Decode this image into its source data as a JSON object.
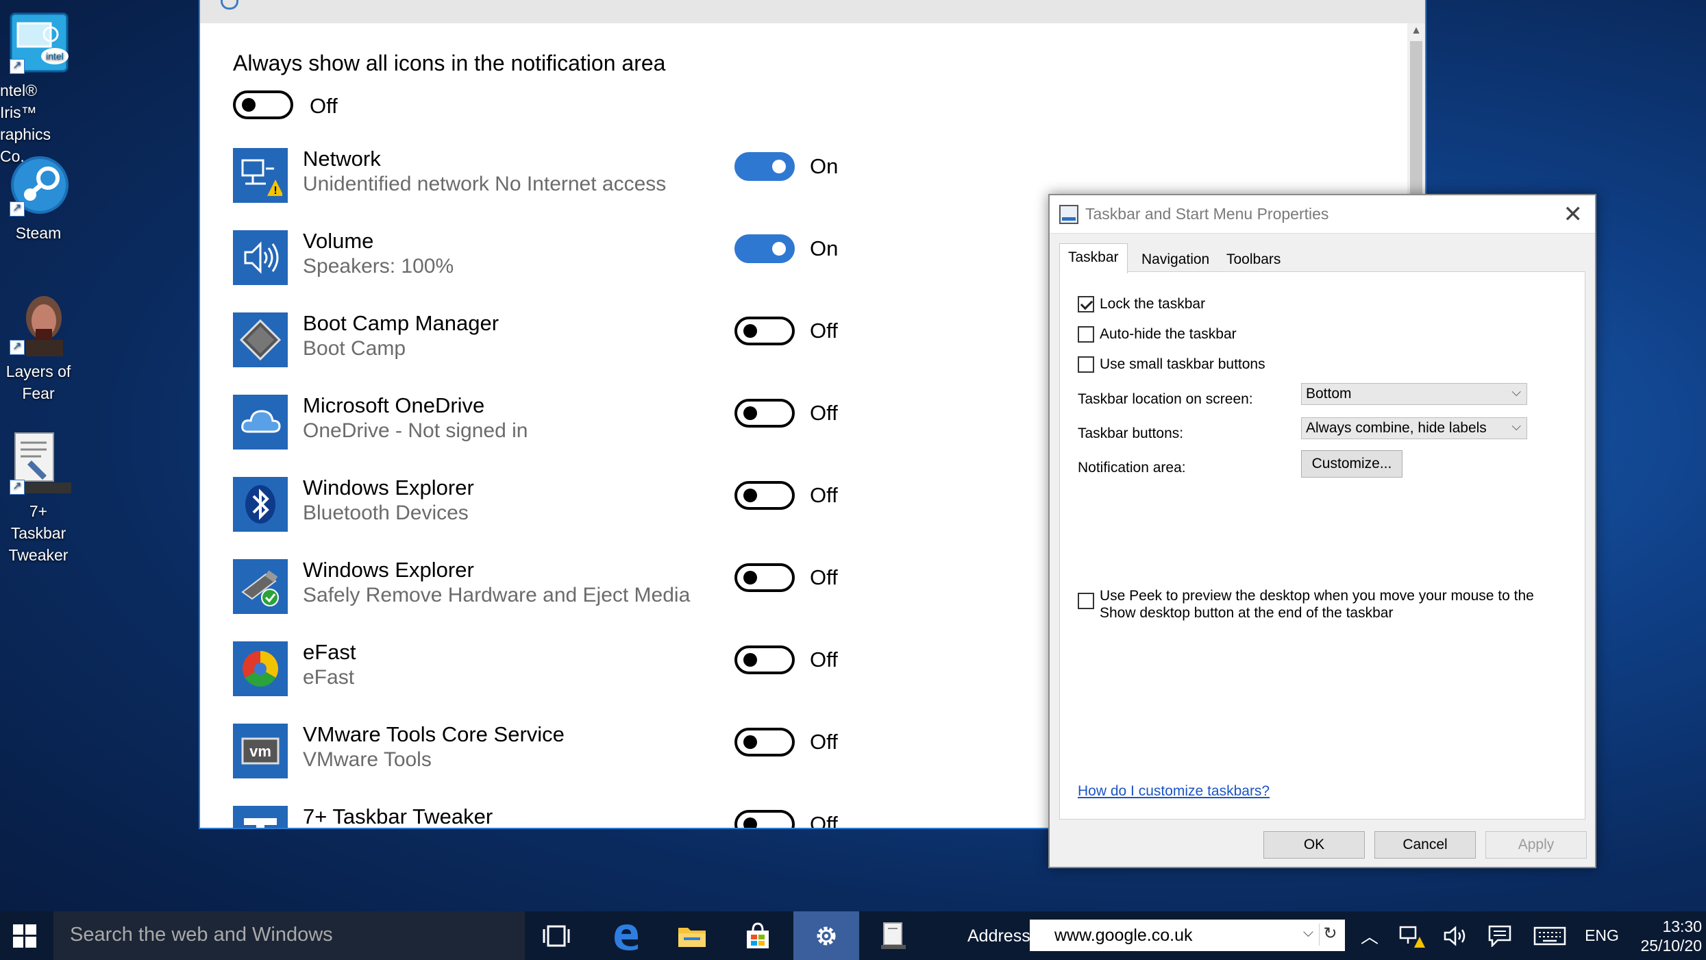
{
  "desktop": {
    "icons": [
      {
        "label": "ntel® Iris™\nraphics Co...",
        "line1": "ntel® Iris™",
        "line2": "raphics Co..."
      },
      {
        "line1": "Steam",
        "line2": ""
      },
      {
        "line1": "Layers of",
        "line2": "Fear"
      },
      {
        "line1": "7+ Taskbar",
        "line2": "Tweaker"
      }
    ]
  },
  "settings": {
    "always_show_title": "Always show all icons in the notification area",
    "always_show_state": "Off",
    "apps": [
      {
        "name": "Network",
        "sub": "Unidentified network No Internet access",
        "state": "On",
        "on": true,
        "icon": "network-warning-icon"
      },
      {
        "name": "Volume",
        "sub": "Speakers: 100%",
        "state": "On",
        "on": true,
        "icon": "speaker-icon"
      },
      {
        "name": "Boot Camp Manager",
        "sub": "Boot Camp",
        "state": "Off",
        "on": false,
        "icon": "bootcamp-diamond-icon"
      },
      {
        "name": "Microsoft OneDrive",
        "sub": "OneDrive - Not signed in",
        "state": "Off",
        "on": false,
        "icon": "cloud-icon"
      },
      {
        "name": "Windows Explorer",
        "sub": "Bluetooth Devices",
        "state": "Off",
        "on": false,
        "icon": "bluetooth-icon"
      },
      {
        "name": "Windows Explorer",
        "sub": "Safely Remove Hardware and Eject Media",
        "state": "Off",
        "on": false,
        "icon": "usb-eject-icon"
      },
      {
        "name": "eFast",
        "sub": "eFast",
        "state": "Off",
        "on": false,
        "icon": "efast-icon"
      },
      {
        "name": "VMware Tools Core Service",
        "sub": "VMware Tools",
        "state": "Off",
        "on": false,
        "icon": "vmware-icon"
      },
      {
        "name": "7+ Taskbar Tweaker",
        "sub": "",
        "state": "Off",
        "on": false,
        "icon": "taskbar-tweaker-icon"
      }
    ]
  },
  "dialog": {
    "title": "Taskbar and Start Menu Properties",
    "tabs": [
      "Taskbar",
      "Navigation",
      "Toolbars"
    ],
    "lock_taskbar": "Lock the taskbar",
    "auto_hide": "Auto-hide the taskbar",
    "small_buttons": "Use small taskbar buttons",
    "location_label": "Taskbar location on screen:",
    "location_value": "Bottom",
    "buttons_label": "Taskbar buttons:",
    "buttons_value": "Always combine, hide labels",
    "notification_label": "Notification area:",
    "customize_button": "Customize...",
    "peek_text": "Use Peek to preview the desktop when you move your mouse to the Show desktop button at the end of the taskbar",
    "help_link": "How do I customize taskbars?",
    "ok": "OK",
    "cancel": "Cancel",
    "apply": "Apply",
    "checked": {
      "lock": true,
      "autohide": false,
      "small": false,
      "peek": false
    }
  },
  "taskbar": {
    "search_placeholder": "Search the web and Windows",
    "address_label": "Address",
    "address_value": "www.google.co.uk",
    "language": "ENG",
    "time": "13:30",
    "date": "25/10/20"
  },
  "colors": {
    "accent": "#2f78d2",
    "taskbar": "#0b1a33",
    "link": "#1a55c5"
  }
}
